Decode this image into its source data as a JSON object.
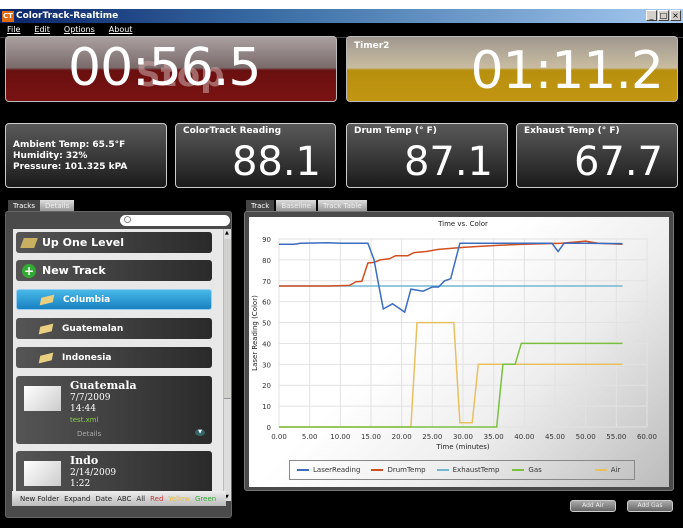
{
  "window": {
    "title": "ColorTrack-Realtime",
    "icon_text": "CT",
    "controls": [
      "_",
      "□",
      "×"
    ]
  },
  "menu": [
    "File",
    "Edit",
    "Options",
    "About"
  ],
  "timer1": {
    "value": "00:56.5",
    "ghost_text": "Stop"
  },
  "timer2": {
    "label": "Timer2",
    "value": "01:11.2"
  },
  "environment": {
    "lines": [
      "Ambient Temp: 65.5°F",
      "Humidity: 32%",
      "Pressure: 101.325 kPA"
    ]
  },
  "readings": [
    {
      "label": "ColorTrack Reading",
      "value": "88.1"
    },
    {
      "label": "Drum Temp (° F)",
      "value": "87.1"
    },
    {
      "label": "Exhaust Temp (° F)",
      "value": "67.7"
    }
  ],
  "left_tabs": [
    "Tracks",
    "Details"
  ],
  "tracks": {
    "search_placeholder": "",
    "nav_items": [
      {
        "label": "Up One Level",
        "icon": "folder-up-icon"
      },
      {
        "label": "New Track",
        "icon": "plus-icon"
      }
    ],
    "folders": [
      {
        "label": "Columbia",
        "selected": true
      },
      {
        "label": "Guatemalan",
        "selected": false
      },
      {
        "label": "Indonesia",
        "selected": false
      }
    ],
    "entries": [
      {
        "name": "Guatemala",
        "date": "7/7/2009",
        "time": "14:44",
        "file": "test.xml",
        "details_label": "Details"
      },
      {
        "name": "Indo",
        "date": "2/14/2009",
        "time": "1:22"
      }
    ],
    "footer": [
      {
        "label": "New Folder",
        "color": "#222"
      },
      {
        "label": "Expand",
        "color": "#222"
      },
      {
        "label": "Date",
        "color": "#222"
      },
      {
        "label": "ABC",
        "color": "#222"
      },
      {
        "label": "All",
        "color": "#222"
      },
      {
        "label": "Red",
        "color": "#c33"
      },
      {
        "label": "Yellow",
        "color": "#e8c040"
      },
      {
        "label": "Green",
        "color": "#3a3"
      }
    ]
  },
  "right_tabs": [
    "Track",
    "Baseline",
    "Track Table"
  ],
  "buttons": {
    "add_air": "Add Air",
    "add_gas": "Add Gas"
  },
  "chart_data": {
    "type": "line",
    "title": "Time vs. Color",
    "xlabel": "Time (minutes)",
    "ylabel": "Laser Reading (Color)",
    "xlim": [
      0,
      60
    ],
    "ylim": [
      0,
      90
    ],
    "xticks": [
      "0.00",
      "5.00",
      "10.00",
      "15.00",
      "20.00",
      "25.00",
      "30.00",
      "35.00",
      "40.00",
      "45.00",
      "50.00",
      "55.00",
      "60.00"
    ],
    "yticks": [
      "0",
      "10",
      "20",
      "30",
      "40",
      "50",
      "60",
      "70",
      "80",
      "90"
    ],
    "grid": true,
    "legend_position": "bottom",
    "series": [
      {
        "name": "LaserReading",
        "color": "#3a6cc0",
        "points": [
          [
            0,
            87.5
          ],
          [
            2.5,
            87.5
          ],
          [
            3.5,
            88
          ],
          [
            8,
            88.2
          ],
          [
            10,
            88
          ],
          [
            14.5,
            88
          ],
          [
            15.5,
            80
          ],
          [
            16,
            72
          ],
          [
            17,
            56.5
          ],
          [
            18.5,
            59
          ],
          [
            20.5,
            55
          ],
          [
            21.5,
            66
          ],
          [
            23.5,
            65
          ],
          [
            25,
            67
          ],
          [
            26,
            67
          ],
          [
            27,
            70
          ],
          [
            28,
            71
          ],
          [
            29.5,
            88
          ],
          [
            44.5,
            88
          ],
          [
            45.5,
            84
          ],
          [
            46.5,
            88
          ],
          [
            50,
            88
          ],
          [
            56,
            87.8
          ]
        ]
      },
      {
        "name": "DrumTemp",
        "color": "#d05020",
        "points": [
          [
            0,
            67.5
          ],
          [
            8,
            67.5
          ],
          [
            11.5,
            67.8
          ],
          [
            12.5,
            69.5
          ],
          [
            13.5,
            69.7
          ],
          [
            14.5,
            78.5
          ],
          [
            15.5,
            78.8
          ],
          [
            16.5,
            80
          ],
          [
            18,
            80.5
          ],
          [
            19,
            82
          ],
          [
            21,
            82
          ],
          [
            22,
            83.5
          ],
          [
            24,
            84
          ],
          [
            26,
            85
          ],
          [
            28,
            85.5
          ],
          [
            30,
            86
          ],
          [
            33,
            86.5
          ],
          [
            36,
            87
          ],
          [
            40,
            87.5
          ],
          [
            46,
            88
          ],
          [
            50,
            89
          ],
          [
            52,
            88
          ],
          [
            56,
            87.5
          ]
        ]
      },
      {
        "name": "ExhaustTemp",
        "color": "#70b8d0",
        "points": [
          [
            0,
            67.5
          ],
          [
            56,
            67.5
          ]
        ]
      },
      {
        "name": "Gas",
        "color": "#7ac040",
        "points": [
          [
            0,
            0
          ],
          [
            35.5,
            0
          ],
          [
            36.5,
            30
          ],
          [
            38.5,
            30
          ],
          [
            39.5,
            40
          ],
          [
            56,
            40
          ]
        ]
      },
      {
        "name": "Air",
        "color": "#e8c060",
        "points": [
          [
            0,
            0
          ],
          [
            21.5,
            0
          ],
          [
            22.5,
            50
          ],
          [
            28.5,
            50
          ],
          [
            29.5,
            2
          ],
          [
            31.5,
            2
          ],
          [
            32.5,
            30
          ],
          [
            56,
            30
          ]
        ]
      }
    ]
  }
}
